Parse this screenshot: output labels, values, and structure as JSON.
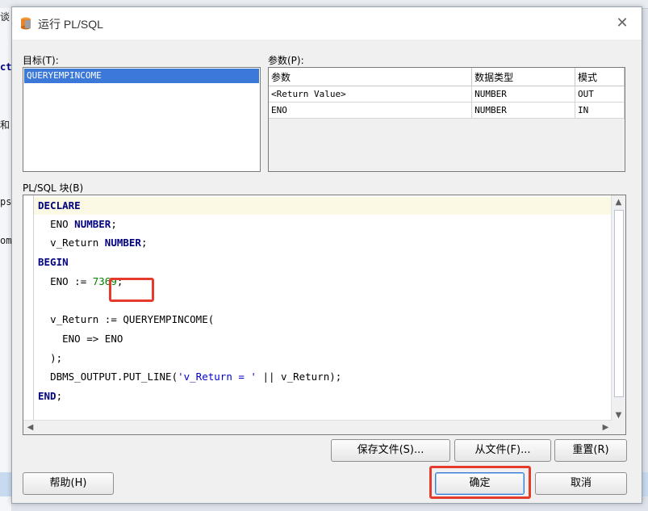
{
  "background": {
    "fragments": [
      "谈",
      "ct",
      "和",
      "ps",
      "om"
    ]
  },
  "dialog": {
    "title": "运行 PL/SQL",
    "close_icon": "close-icon"
  },
  "target": {
    "label": "目标(T):",
    "items": [
      "QUERYEMPINCOME"
    ]
  },
  "params": {
    "label": "参数(P):",
    "headers": [
      "参数",
      "数据类型",
      "模式"
    ],
    "rows": [
      [
        "<Return Value>",
        "NUMBER",
        "OUT"
      ],
      [
        "ENO",
        "NUMBER",
        "IN"
      ]
    ]
  },
  "code": {
    "label": "PL/SQL 块(B)",
    "declare": "DECLARE",
    "eno_var": "ENO ",
    "number_kw": "NUMBER",
    "semicolon": ";",
    "vreturn_var": "v_Return ",
    "begin": "BEGIN",
    "eno_assign": "ENO := ",
    "eno_value": "7369",
    "call_line": "v_Return := QUERYEMPINCOME(",
    "arg_line": "ENO => ENO",
    "close_paren": ");",
    "put_prefix": "DBMS_OUTPUT.PUT_LINE(",
    "put_string": "'v_Return = '",
    "put_suffix": " || v_Return);",
    "end": "END",
    "end_semi": ";"
  },
  "buttons": {
    "save_file": "保存文件(S)...",
    "from_file": "从文件(F)...",
    "reset": "重置(R)",
    "help": "帮助(H)",
    "ok": "确定",
    "cancel": "取消"
  },
  "colors": {
    "selection": "#3b78d8",
    "highlight_box": "#e53b2d",
    "keyword": "#000080",
    "number_literal": "#008000",
    "string_literal": "#0000d0"
  }
}
